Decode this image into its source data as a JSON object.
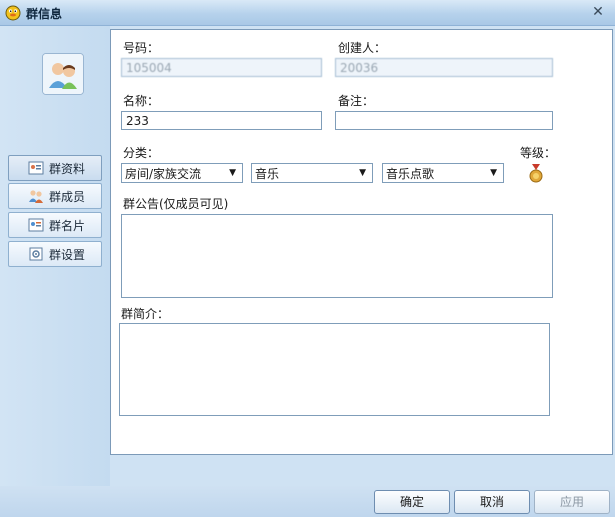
{
  "window": {
    "title": "群信息",
    "close_glyph": "✕"
  },
  "sidebar": {
    "items": [
      {
        "label": "群资料",
        "icon": "group-profile-icon",
        "active": true
      },
      {
        "label": "群成员",
        "icon": "members-icon",
        "active": false
      },
      {
        "label": "群名片",
        "icon": "card-icon",
        "active": false
      },
      {
        "label": "群设置",
        "icon": "settings-icon",
        "active": false
      }
    ]
  },
  "form": {
    "number_label": "号码：",
    "number_value": "105004",
    "creator_label": "创建人：",
    "creator_value": "20036",
    "name_label": "名称：",
    "name_value": "233",
    "note_label": "备注：",
    "note_value": "",
    "category_label": "分类：",
    "category_1": "房间/家族交流",
    "category_2": "音乐",
    "category_3": "音乐点歌",
    "level_label": "等级：",
    "notice_label": "群公告(仅成员可见)",
    "notice_value": "",
    "intro_label": "群简介：",
    "intro_value": ""
  },
  "footer": {
    "ok_label": "确定",
    "cancel_label": "取消",
    "apply_label": "应用"
  },
  "colors": {
    "accent": "#7f9db9",
    "panel_bg": "#cfe2f3",
    "medal": "#d9a032"
  }
}
